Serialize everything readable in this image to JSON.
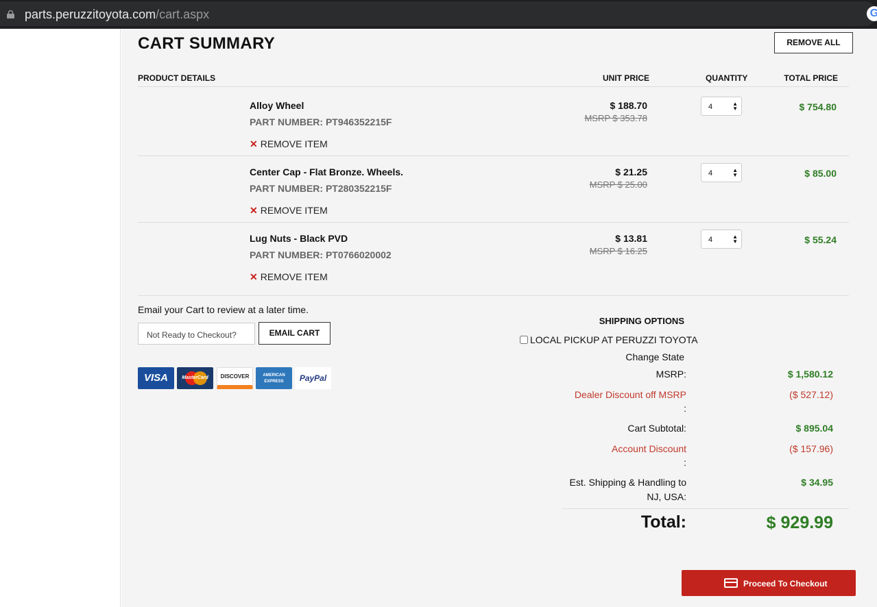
{
  "browser": {
    "url_domain": "parts.peruzzitoyota.com",
    "url_path": "/cart.aspx"
  },
  "cart": {
    "title": "CART SUMMARY",
    "remove_all_label": "REMOVE ALL",
    "columns": {
      "product": "PRODUCT DETAILS",
      "unit_price": "UNIT PRICE",
      "quantity": "QUANTITY",
      "total_price": "TOTAL PRICE"
    },
    "items": [
      {
        "name": "Alloy Wheel",
        "part_number": "PART NUMBER: PT946352215F",
        "unit_price": "$ 188.70",
        "msrp": "MSRP $ 353.78",
        "quantity": "4",
        "total": "$ 754.80",
        "remove_label": "REMOVE ITEM"
      },
      {
        "name": "Center Cap - Flat Bronze. Wheels.",
        "part_number": "PART NUMBER: PT280352215F",
        "unit_price": "$ 21.25",
        "msrp": "MSRP $ 25.00",
        "quantity": "4",
        "total": "$ 85.00",
        "remove_label": "REMOVE ITEM"
      },
      {
        "name": "Lug Nuts - Black PVD",
        "part_number": "PART NUMBER: PT0766020002",
        "unit_price": "$ 13.81",
        "msrp": "MSRP $ 16.25",
        "quantity": "4",
        "total": "$ 55.24",
        "remove_label": "REMOVE ITEM"
      }
    ]
  },
  "email": {
    "prompt": "Email your Cart to review at a later time.",
    "placeholder": "Not Ready to Checkout?",
    "button_label": "EMAIL CART"
  },
  "payment_cards": [
    "VISA",
    "MasterCard",
    "DISCOVER",
    "AMERICAN EXPRESS",
    "PayPal"
  ],
  "shipping": {
    "title": "SHIPPING OPTIONS",
    "pickup_label": "LOCAL PICKUP AT PERUZZI TOYOTA",
    "change_state": "Change State"
  },
  "summary": {
    "msrp_label": "MSRP:",
    "msrp_value": "$ 1,580.12",
    "dealer_discount_label": "Dealer Discount off MSRP",
    "dealer_discount_colon": ":",
    "dealer_discount_value": "($ 527.12)",
    "subtotal_label": "Cart Subtotal:",
    "subtotal_value": "$ 895.04",
    "account_discount_label": "Account Discount",
    "account_discount_colon": ":",
    "account_discount_value": "($ 157.96)",
    "shipping_label_1": "Est. Shipping & Handling to",
    "shipping_label_2": "NJ, USA:",
    "shipping_value": "$ 34.95",
    "total_label": "Total:",
    "total_value": "$ 929.99"
  },
  "checkout_label": "Proceed To Checkout",
  "colors": {
    "accent_red": "#c2231c",
    "price_green": "#2e7d24",
    "discount_red": "#c0392b"
  }
}
